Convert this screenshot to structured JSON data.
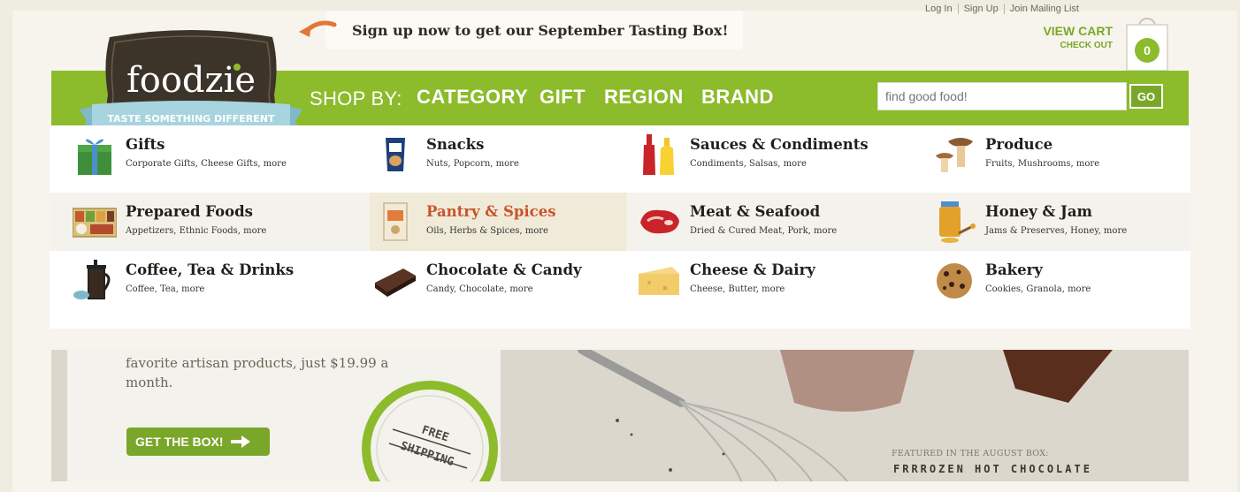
{
  "promo": {
    "text": "Sign up now to get our September Tasting Box!"
  },
  "account": {
    "login": "Log In",
    "signup": "Sign Up",
    "mailing": "Join Mailing List"
  },
  "cart": {
    "view": "VIEW CART",
    "checkout": "CHECK OUT",
    "count": "0"
  },
  "logo": {
    "name": "foodzie",
    "tagline": "TASTE SOMETHING DIFFERENT"
  },
  "nav": {
    "shopby": "SHOP BY:",
    "links": [
      "CATEGORY",
      "GIFT",
      "REGION",
      "BRAND"
    ]
  },
  "search": {
    "placeholder": "find good food!",
    "button": "GO"
  },
  "categories": [
    [
      {
        "name": "Gifts",
        "sub": "Corporate Gifts, Cheese Gifts, more",
        "icon": "gift-icon"
      },
      {
        "name": "Snacks",
        "sub": "Nuts, Popcorn, more",
        "icon": "snack-bag-icon"
      },
      {
        "name": "Sauces & Condiments",
        "sub": "Condiments, Salsas, more",
        "icon": "sauce-bottles-icon"
      },
      {
        "name": "Produce",
        "sub": "Fruits, Mushrooms, more",
        "icon": "mushroom-icon"
      }
    ],
    [
      {
        "name": "Prepared Foods",
        "sub": "Appetizers, Ethnic Foods, more",
        "icon": "bento-tray-icon"
      },
      {
        "name": "Pantry & Spices",
        "sub": "Oils, Herbs & Spices, more",
        "icon": "spice-packet-icon"
      },
      {
        "name": "Meat & Seafood",
        "sub": "Dried & Cured Meat, Pork, more",
        "icon": "steak-icon"
      },
      {
        "name": "Honey & Jam",
        "sub": "Jams & Preserves, Honey, more",
        "icon": "honey-jar-icon"
      }
    ],
    [
      {
        "name": "Coffee, Tea & Drinks",
        "sub": "Coffee, Tea, more",
        "icon": "french-press-icon"
      },
      {
        "name": "Chocolate & Candy",
        "sub": "Candy, Chocolate, more",
        "icon": "chocolate-icon"
      },
      {
        "name": "Cheese & Dairy",
        "sub": "Cheese, Butter, more",
        "icon": "cheese-icon"
      },
      {
        "name": "Bakery",
        "sub": "Cookies, Granola, more",
        "icon": "cookie-icon"
      }
    ]
  ],
  "hero": {
    "text": "favorite artisan products, just $19.99 a month.",
    "button": "GET THE BOX!",
    "stamp_line1": "FREE",
    "stamp_line2": "SHIPPING",
    "featured_label": "FEATURED IN THE AUGUST BOX:",
    "featured_name": "FRRROZEN HOT CHOCOLATE"
  },
  "colors": {
    "brand_green": "#8cbb2c",
    "accent_orange": "#e2763a",
    "active_category": "#c8542b"
  }
}
